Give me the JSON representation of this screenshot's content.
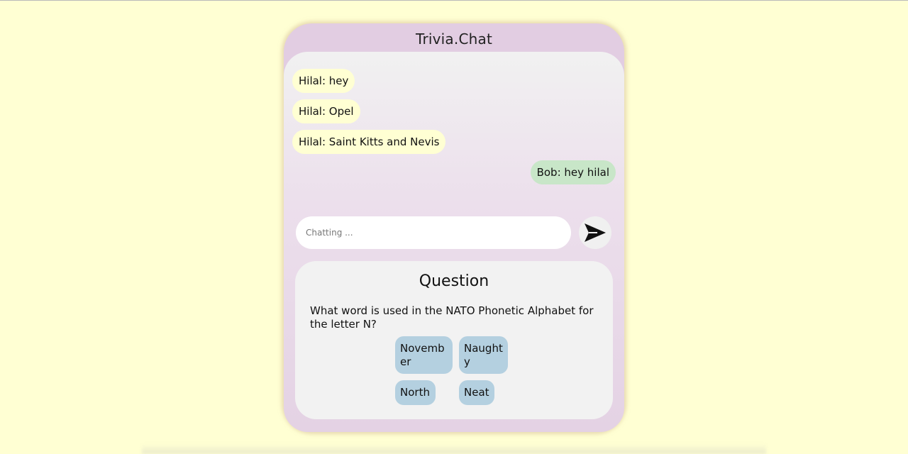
{
  "app": {
    "title": "Trivia.Chat"
  },
  "messages": [
    {
      "text": "Hilal: hey",
      "side": "left"
    },
    {
      "text": "Hilal: Opel",
      "side": "left"
    },
    {
      "text": "Hilal: Saint Kitts and Nevis",
      "side": "left"
    },
    {
      "text": "Bob: hey hilal",
      "side": "right"
    }
  ],
  "chat": {
    "placeholder": "Chatting ...",
    "value": "",
    "send_icon": "send-arrow-icon"
  },
  "question": {
    "heading": "Question",
    "text": "What word is used in the NATO Phonetic Alphabet for the letter N?",
    "answers": [
      "November",
      "Naughty",
      "North",
      "Neat"
    ]
  },
  "colors": {
    "page_background": "#ffffd3",
    "app_frame": "#e2cde2",
    "message_other": "#ffffd3",
    "message_self": "#c8e6c8",
    "answer_button": "#b4d0e0",
    "question_card": "#f2f2f2"
  }
}
